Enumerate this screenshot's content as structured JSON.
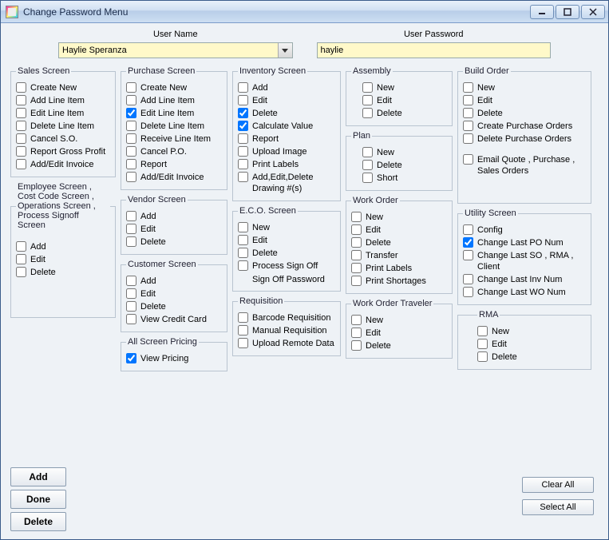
{
  "window": {
    "title": "Change Password Menu"
  },
  "top": {
    "username_label": "User Name",
    "password_label": "User Password",
    "username_value": "Haylie Speranza",
    "password_value": "haylie"
  },
  "groups": {
    "sales": {
      "legend": "Sales Screen",
      "items": [
        {
          "label": "Create New",
          "checked": false
        },
        {
          "label": "Add Line Item",
          "checked": false
        },
        {
          "label": "Edit Line Item",
          "checked": false
        },
        {
          "label": "Delete Line Item",
          "checked": false
        },
        {
          "label": "Cancel S.O.",
          "checked": false
        },
        {
          "label": "Report Gross Profit",
          "checked": false
        },
        {
          "label": "Add/Edit Invoice",
          "checked": false
        }
      ]
    },
    "employee": {
      "legend": "Employee Screen , Cost Code Screen , Operations Screen , Process Signoff Screen",
      "items": [
        {
          "label": "Add",
          "checked": false
        },
        {
          "label": "Edit",
          "checked": false
        },
        {
          "label": "Delete",
          "checked": false
        }
      ]
    },
    "purchase": {
      "legend": "Purchase Screen",
      "items": [
        {
          "label": "Create New",
          "checked": false
        },
        {
          "label": "Add Line Item",
          "checked": false
        },
        {
          "label": "Edit Line Item",
          "checked": true
        },
        {
          "label": "Delete Line Item",
          "checked": false
        },
        {
          "label": "Receive Line Item",
          "checked": false
        },
        {
          "label": "Cancel P.O.",
          "checked": false
        },
        {
          "label": "Report",
          "checked": false
        },
        {
          "label": "Add/Edit Invoice",
          "checked": false
        }
      ]
    },
    "vendor": {
      "legend": "Vendor Screen",
      "items": [
        {
          "label": "Add",
          "checked": false
        },
        {
          "label": "Edit",
          "checked": false
        },
        {
          "label": "Delete",
          "checked": false
        }
      ]
    },
    "customer": {
      "legend": "Customer Screen",
      "items": [
        {
          "label": "Add",
          "checked": false
        },
        {
          "label": "Edit",
          "checked": false
        },
        {
          "label": "Delete",
          "checked": false
        },
        {
          "label": "View Credit Card",
          "checked": false
        }
      ]
    },
    "pricing": {
      "legend": "All Screen Pricing",
      "items": [
        {
          "label": "View Pricing",
          "checked": true
        }
      ]
    },
    "inventory": {
      "legend": "Inventory Screen",
      "items": [
        {
          "label": "Add",
          "checked": false
        },
        {
          "label": "Edit",
          "checked": false
        },
        {
          "label": "Delete",
          "checked": true
        },
        {
          "label": "Calculate Value",
          "checked": true
        },
        {
          "label": "Report",
          "checked": false
        },
        {
          "label": "Upload Image",
          "checked": false
        },
        {
          "label": "Print Labels",
          "checked": false
        },
        {
          "label": "Add,Edit,Delete Drawing #(s)",
          "checked": false
        }
      ]
    },
    "eco": {
      "legend": "E.C.O. Screen",
      "items": [
        {
          "label": "New",
          "checked": false
        },
        {
          "label": "Edit",
          "checked": false
        },
        {
          "label": "Delete",
          "checked": false
        },
        {
          "label": "Process Sign Off",
          "checked": false
        }
      ],
      "signoff_label": "Sign Off Password"
    },
    "requisition": {
      "legend": "Requisition",
      "items": [
        {
          "label": "Barcode Requisition",
          "checked": false
        },
        {
          "label": "Manual Requisition",
          "checked": false
        },
        {
          "label": "Upload Remote Data",
          "checked": false
        }
      ]
    },
    "assembly": {
      "legend": "Assembly",
      "items": [
        {
          "label": "New",
          "checked": false
        },
        {
          "label": "Edit",
          "checked": false
        },
        {
          "label": "Delete",
          "checked": false
        }
      ]
    },
    "plan": {
      "legend": "Plan",
      "items": [
        {
          "label": "New",
          "checked": false
        },
        {
          "label": "Delete",
          "checked": false
        },
        {
          "label": "Short",
          "checked": false
        }
      ]
    },
    "workorder": {
      "legend": "Work Order",
      "items": [
        {
          "label": "New",
          "checked": false
        },
        {
          "label": "Edit",
          "checked": false
        },
        {
          "label": "Delete",
          "checked": false
        },
        {
          "label": "Transfer",
          "checked": false
        },
        {
          "label": "Print Labels",
          "checked": false
        },
        {
          "label": "Print Shortages",
          "checked": false
        }
      ]
    },
    "traveler": {
      "legend": "Work Order Traveler",
      "items": [
        {
          "label": "New",
          "checked": false
        },
        {
          "label": "Edit",
          "checked": false
        },
        {
          "label": "Delete",
          "checked": false
        }
      ]
    },
    "build": {
      "legend": "Build Order",
      "items": [
        {
          "label": "New",
          "checked": false
        },
        {
          "label": "Edit",
          "checked": false
        },
        {
          "label": "Delete",
          "checked": false
        },
        {
          "label": "Create Purchase Orders",
          "checked": false
        },
        {
          "label": "Delete Purchase Orders",
          "checked": false
        },
        {
          "label": "Email Quote , Purchase , Sales Orders",
          "checked": false
        }
      ]
    },
    "utility": {
      "legend": "Utility Screen",
      "items": [
        {
          "label": "Config",
          "checked": false
        },
        {
          "label": "Change Last PO Num",
          "checked": true
        },
        {
          "label": "Change Last SO , RMA , Client",
          "checked": false
        },
        {
          "label": "Change Last Inv Num",
          "checked": false
        },
        {
          "label": "Change Last WO Num",
          "checked": false
        }
      ]
    },
    "rma": {
      "legend": "RMA",
      "items": [
        {
          "label": "New",
          "checked": false
        },
        {
          "label": "Edit",
          "checked": false
        },
        {
          "label": "Delete",
          "checked": false
        }
      ]
    }
  },
  "buttons": {
    "add": "Add",
    "done": "Done",
    "delete": "Delete",
    "clear_all": "Clear All",
    "select_all": "Select All"
  }
}
